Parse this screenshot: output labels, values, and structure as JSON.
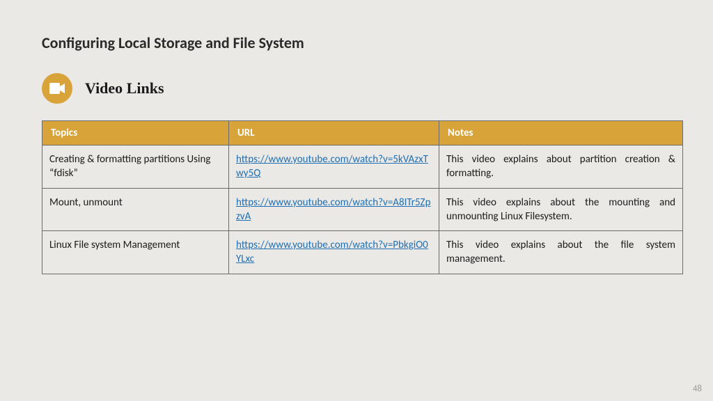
{
  "title": "Configuring Local Storage and File System",
  "section": "Video Links",
  "headers": {
    "c1": "Topics",
    "c2": "URL",
    "c3": "Notes"
  },
  "rows": [
    {
      "topic": "Creating & formatting partitions Using “fdisk”",
      "url": "https://www.youtube.com/watch?v=5kVAzxTwy5Q",
      "notes": "This video explains about partition creation & formatting."
    },
    {
      "topic": "Mount, unmount",
      "url": "https://www.youtube.com/watch?v=A8ITr5ZpzvA",
      "notes": "This video explains about the mounting and unmounting Linux Filesystem."
    },
    {
      "topic": "Linux File system Management",
      "url": "https://www.youtube.com/watch?v=PbkgiO0YLxc",
      "notes": "This video explains about the file system management."
    }
  ],
  "page_number": "48"
}
